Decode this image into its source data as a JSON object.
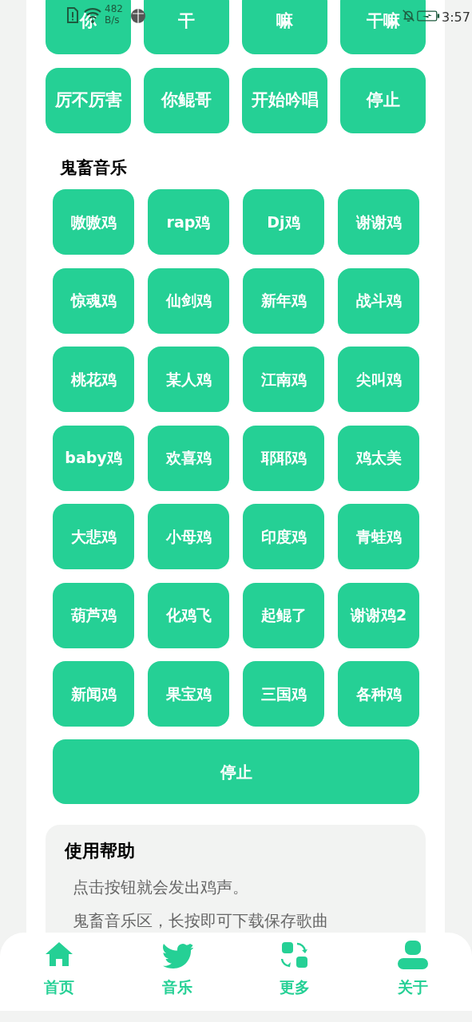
{
  "status_bar": {
    "network_speed": "482 B/s",
    "time": "3:57"
  },
  "top_buttons": [
    "你",
    "干",
    "嘛",
    "干嘛",
    "厉不厉害",
    "你鲲哥",
    "开始吟唱",
    "停止"
  ],
  "section": {
    "title": "鬼畜音乐",
    "buttons": [
      "嗷嗷鸡",
      "rap鸡",
      "Dj鸡",
      "谢谢鸡",
      "惊魂鸡",
      "仙剑鸡",
      "新年鸡",
      "战斗鸡",
      "桃花鸡",
      "某人鸡",
      "江南鸡",
      "尖叫鸡",
      "baby鸡",
      "欢喜鸡",
      "耶耶鸡",
      "鸡太美",
      "大悲鸡",
      "小母鸡",
      "印度鸡",
      "青蛙鸡",
      "葫芦鸡",
      "化鸡飞",
      "起鲲了",
      "谢谢鸡2",
      "新闻鸡",
      "果宝鸡",
      "三国鸡",
      "各种鸡"
    ],
    "stop_button": "停止"
  },
  "help": {
    "title": "使用帮助",
    "lines": [
      "点击按钮就会发出鸡声。",
      "鬼畜音乐区，长按即可下载保存歌曲"
    ]
  },
  "bottom_nav": [
    {
      "label": "首页"
    },
    {
      "label": "音乐"
    },
    {
      "label": "更多"
    },
    {
      "label": "关于"
    }
  ]
}
